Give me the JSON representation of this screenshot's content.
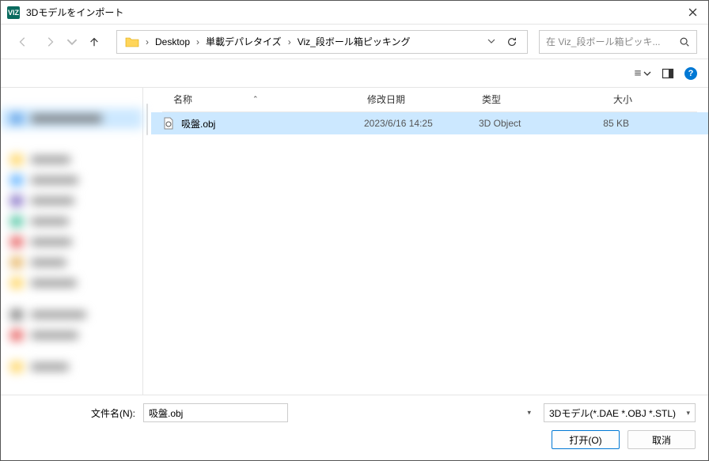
{
  "window": {
    "title": "3Dモデルをインポート",
    "app_icon_text": "VIZ"
  },
  "breadcrumb": {
    "items": [
      "Desktop",
      "単載デパレタイズ",
      "Viz_段ボール箱ピッキング"
    ]
  },
  "search": {
    "placeholder": "在 Viz_段ボール箱ピッキ..."
  },
  "columns": {
    "name": "名称",
    "date": "修改日期",
    "type": "类型",
    "size": "大小"
  },
  "files": [
    {
      "name": "吸盤.obj",
      "date": "2023/6/16 14:25",
      "type": "3D Object",
      "size": "85 KB"
    }
  ],
  "footer": {
    "filename_label": "文件名(N):",
    "filename_value": "吸盤.obj",
    "filetype": "3Dモデル(*.DAE *.OBJ *.STL)",
    "open": "打开(O)",
    "cancel": "取消"
  }
}
